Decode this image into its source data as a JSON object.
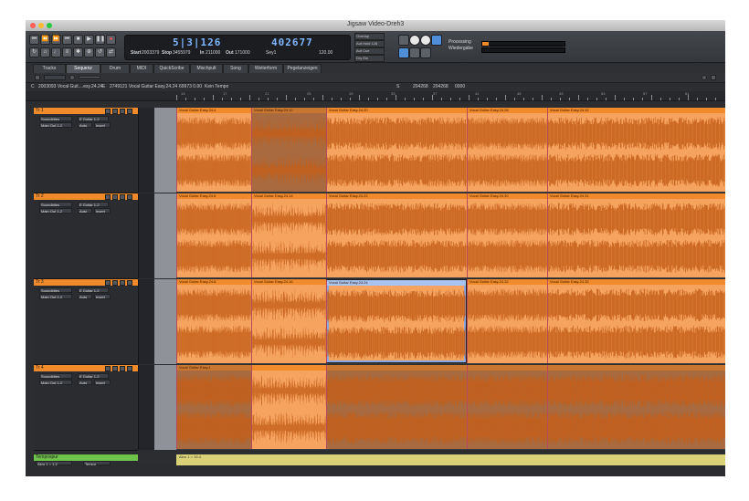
{
  "window": {
    "title": "Jigsaw Video-Dreh3"
  },
  "transport": {
    "time_display": "5|3|126",
    "samples_display": "402677",
    "start_label": "Start",
    "start_value": "2003379",
    "stop_label": "Stop",
    "stop_value": "3455979",
    "in_label": "In",
    "in_value": "211000",
    "out_label": "Out",
    "out_value": "171000",
    "sync_label": "Sey1",
    "tempo_value": "120.00"
  },
  "options": {
    "sel1": "Overlap",
    "sel2": "Auf Hold 128",
    "sel3": "Auf Cue Manager",
    "sel4": "Dry Ein"
  },
  "processing": {
    "label1": "Processing",
    "label2": "Wiedergabe",
    "level": 0.08
  },
  "tabs": [
    "Tracks",
    "Sequenz",
    "Drum",
    "MIDI",
    "QuickScribe",
    "Mischpult",
    "Song",
    "Weiterform",
    "Pegelanzeigen"
  ],
  "active_tab": "Sequenz",
  "info": {
    "c_label": "C",
    "c_value": "2003093 Vocal Guit....esy.24.24",
    "e_label": "E",
    "e_value": "2749121 Vocal Guitar Easy.24.24",
    "pos": "69973 0.00",
    "tempo_mode": "Kein Tempo",
    "s_label": "S",
    "s1": "204268",
    "s2": "204268",
    "s3": "0000"
  },
  "ruler": [
    "13",
    "17",
    "21",
    "25",
    "29",
    "33",
    "37",
    "41",
    "45",
    "49",
    "53",
    "57",
    "61"
  ],
  "tracks": [
    {
      "name": "Tr 1",
      "out": "Soundbites",
      "in": "E Guitar 1-2",
      "bus": "Main Out 1-2",
      "auto": "Auto",
      "mode": "Insert",
      "clips": [
        {
          "label": "Vocal Guitar Easy.24.4",
          "style": "normal"
        },
        {
          "label": "Vocal Guitar Easy.24.12",
          "style": "darker"
        },
        {
          "label": "Vocal Guitar Easy.24.20",
          "style": "normal"
        },
        {
          "label": "Vocal Guitar Easy.24.28",
          "style": "normal"
        },
        {
          "label": "Vocal Guitar Easy.24.32",
          "style": "normal"
        }
      ]
    },
    {
      "name": "Tr 2",
      "out": "Soundbites",
      "in": "E Guitar 1-2",
      "bus": "Main Out 1-2",
      "auto": "Auto",
      "mode": "Insert",
      "clips": [
        {
          "label": "Vocal Guitar Easy.24.6",
          "style": "normal"
        },
        {
          "label": "Vocal Guitar Easy.24.14",
          "style": "normal"
        },
        {
          "label": "Vocal Guitar Easy.24.22",
          "style": "normal"
        },
        {
          "label": "Vocal Guitar Easy.24.30",
          "style": "normal"
        },
        {
          "label": "Vocal Guitar Easy.24.31",
          "style": "normal"
        }
      ]
    },
    {
      "name": "Tr 3",
      "out": "Soundbites",
      "in": "E Guitar 1-2",
      "bus": "Main Out 1-2",
      "auto": "Auto",
      "mode": "Insert",
      "clips": [
        {
          "label": "Vocal Guitar Easy.24.8",
          "style": "normal"
        },
        {
          "label": "Vocal Guitar Easy.24.16",
          "style": "normal"
        },
        {
          "label": "Vocal Guitar Easy.24.24",
          "style": "selected"
        },
        {
          "label": "Vocal Guitar Easy.24.32",
          "style": "normal"
        },
        {
          "label": "Vocal Guitar Easy.24.35",
          "style": "normal"
        }
      ]
    },
    {
      "name": "Tr 4",
      "out": "Soundbites",
      "in": "E Guitar 1-2",
      "bus": "Main Out 1-2",
      "auto": "Auto",
      "mode": "Insert",
      "clips": [
        {
          "label": "Vocal Guitar Easy.1",
          "style": "darker"
        },
        {
          "label": "",
          "style": "normal"
        },
        {
          "label": "",
          "style": "darker"
        },
        {
          "label": "",
          "style": "darker"
        },
        {
          "label": "",
          "style": "darker"
        }
      ]
    }
  ],
  "tempo_track": {
    "name": "Tempospur",
    "sub": "Akro 1 = 1-2",
    "mode": "Tempo",
    "lane_text": "Akro 1 = 15.4"
  },
  "colors": {
    "clip": "#f5a35f",
    "clip_header": "#f08a2a",
    "wave": "#c45f1a",
    "selected": "#8aa8e0",
    "tempo": "#d9d277"
  }
}
